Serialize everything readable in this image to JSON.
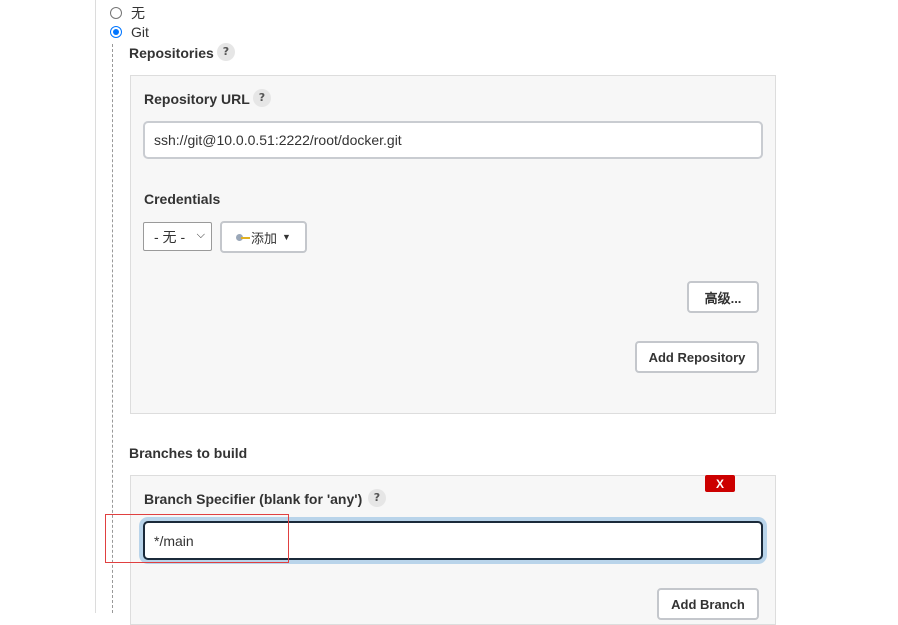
{
  "scm": {
    "options": [
      {
        "label": "无",
        "checked": false
      },
      {
        "label": "Git",
        "checked": true
      }
    ]
  },
  "repositories": {
    "label": "Repositories",
    "help": "?",
    "repository_url": {
      "label": "Repository URL",
      "help": "?",
      "value": "ssh://git@10.0.0.51:2222/root/docker.git"
    },
    "credentials": {
      "label": "Credentials",
      "selected": "- 无 -",
      "add_button": "添加"
    },
    "advanced_button": "高级...",
    "add_repository_button": "Add Repository"
  },
  "branches": {
    "label": "Branches to build",
    "delete_button": "X",
    "branch_specifier": {
      "label": "Branch Specifier (blank for 'any')",
      "help": "?",
      "value": "*/main"
    },
    "add_branch_button": "Add Branch"
  },
  "colors": {
    "focus_border": "#1b2a3a",
    "focus_glow": "#b9d4ea",
    "delete_red": "#cc0000",
    "highlight_red": "#e04040"
  }
}
